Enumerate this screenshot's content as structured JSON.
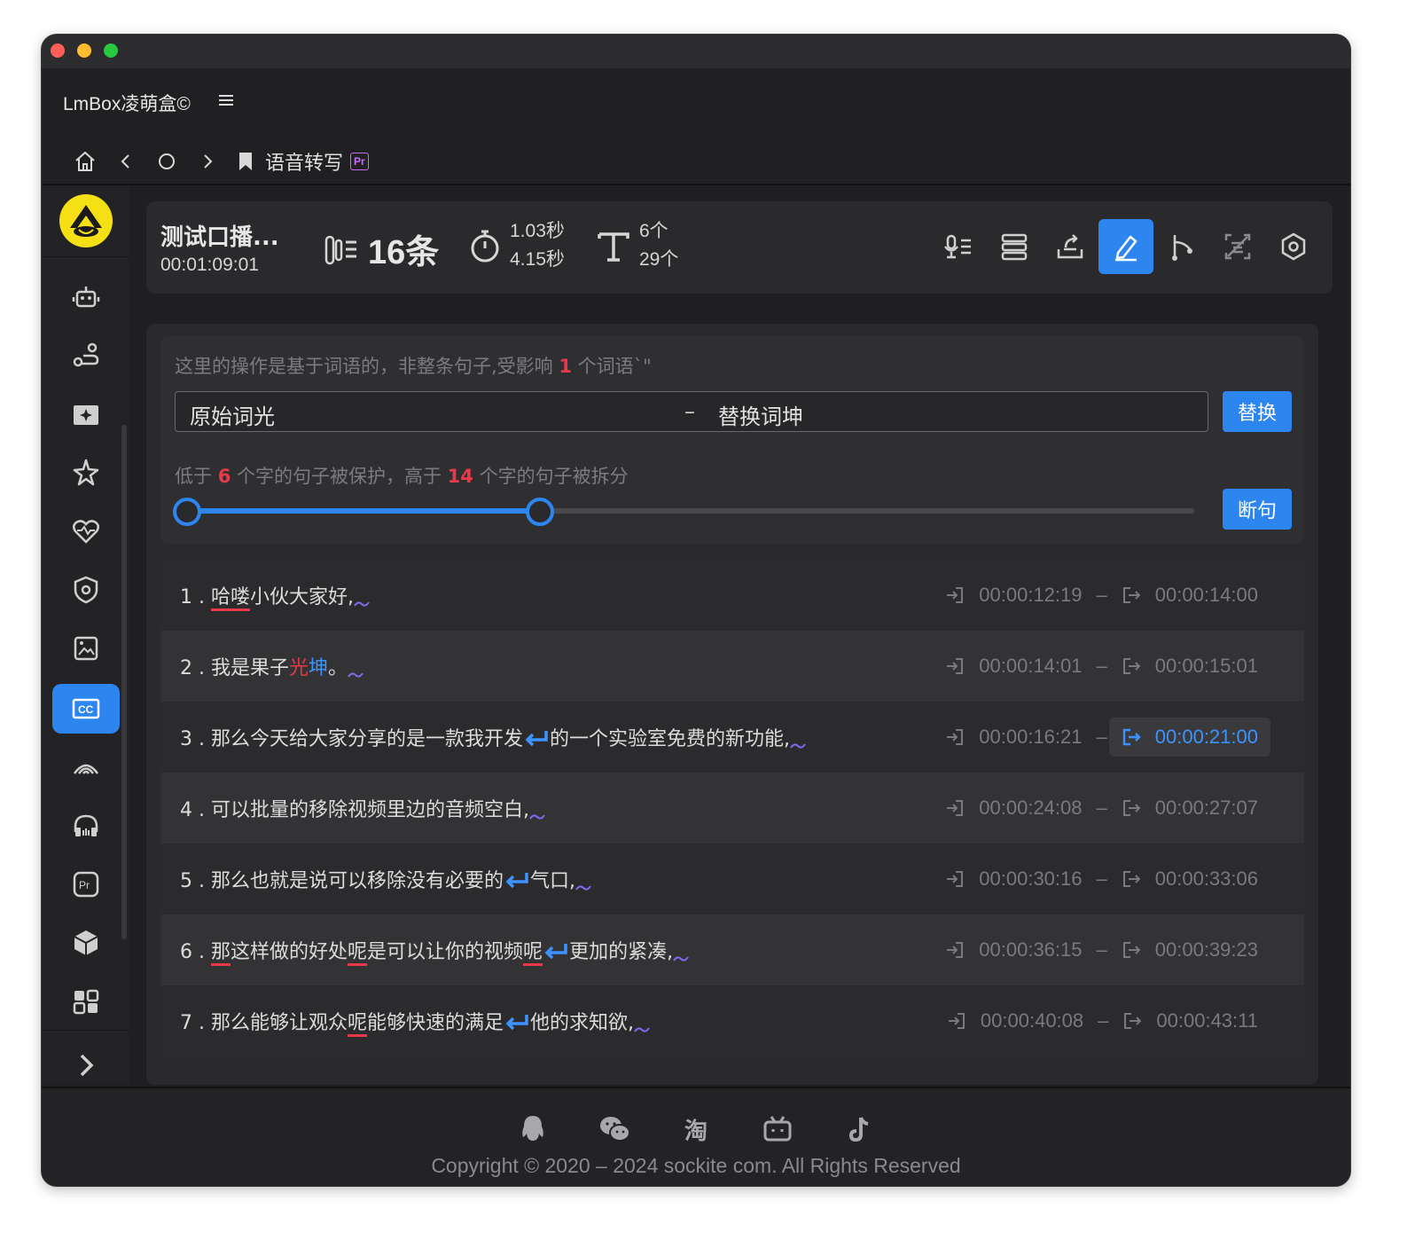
{
  "app": {
    "name": "LmBox凌萌盒©",
    "menu_icon": "menu-icon"
  },
  "nav": {
    "home_icon": "home-icon",
    "back_icon": "chevron-left-icon",
    "reload_icon": "circle-icon",
    "forward_icon": "chevron-right-icon",
    "bookmark_icon": "bookmark-icon",
    "breadcrumb": "语音转写",
    "badge": "Pr"
  },
  "sidebar": {
    "items": [
      {
        "icon": "robot-icon"
      },
      {
        "icon": "route-icon"
      },
      {
        "icon": "video-magic-icon"
      },
      {
        "icon": "sparkle-star-icon"
      },
      {
        "icon": "heartbeat-icon"
      },
      {
        "icon": "shield-icon"
      },
      {
        "icon": "image-icon"
      },
      {
        "icon": "cc-icon",
        "active": true
      },
      {
        "icon": "signal-icon"
      },
      {
        "icon": "headphones-icon"
      },
      {
        "icon": "premiere-icon"
      },
      {
        "icon": "cube-icon"
      },
      {
        "icon": "puzzle-icon"
      }
    ],
    "expand_icon": "chevron-right-icon"
  },
  "stats": {
    "title": "测试口播...",
    "duration": "00:01:09:01",
    "count": "16条",
    "time_min": "1.03秒",
    "time_max": "4.15秒",
    "chars_min": "6个",
    "chars_max": "29个"
  },
  "toolbar": {
    "buttons": [
      {
        "icon": "mic-list-icon"
      },
      {
        "icon": "stack-icon"
      },
      {
        "icon": "export-icon"
      },
      {
        "icon": "edit-icon",
        "active": true
      },
      {
        "icon": "branch-icon"
      },
      {
        "icon": "scan-icon"
      },
      {
        "icon": "settings-icon"
      }
    ]
  },
  "word_op": {
    "note_prefix": "这里的操作是基于词语的，非整条句子,受影响 ",
    "note_count": "1",
    "note_suffix": " 个词语`\"",
    "original": "原始词光",
    "dash": "–",
    "replacement": "替换词坤",
    "replace_label": "替换"
  },
  "split_op": {
    "prefix": "低于 ",
    "min": "6",
    "middle": " 个字的句子被保护，高于 ",
    "max": "14",
    "suffix": " 个字的句子被拆分",
    "button": "断句",
    "handle_a": 0,
    "handle_b": 0.35
  },
  "sentences": [
    {
      "num": "1 .",
      "in": "00:00:12:19",
      "out": "00:00:14:00"
    },
    {
      "num": "2 .",
      "in": "00:00:14:01",
      "out": "00:00:15:01"
    },
    {
      "num": "3 .",
      "in": "00:00:16:21",
      "out": "00:00:21:00"
    },
    {
      "num": "4 .",
      "in": "00:00:24:08",
      "out": "00:00:27:07"
    },
    {
      "num": "5 .",
      "in": "00:00:30:16",
      "out": "00:00:33:06"
    },
    {
      "num": "6 .",
      "in": "00:00:36:15",
      "out": "00:00:39:23"
    },
    {
      "num": "7 .",
      "in": "00:00:40:08",
      "out": "00:00:43:11"
    }
  ],
  "sentence_text": {
    "s1a": "哈喽",
    "s1b": "小伙大家好",
    "s2a": "我是果子",
    "s2b": "光",
    "s2c": "坤",
    "s2d": "。",
    "s3a": "那么今天给大家分享的是一款我开发",
    "s3b": "的一个实验室免费的新功能",
    "s4a": "可以批量的移除视频里边的音频空白",
    "s5a": "那么也就是说可以移除没有必要的",
    "s5b": "气口",
    "s6a": "那",
    "s6b": "这样做的好处",
    "s6c": "呢",
    "s6d": "是可以让你的视频",
    "s6e": "呢",
    "s6f": "更加的紧凑",
    "s7a": "那么能够让观众",
    "s7b": "呢",
    "s7c": "能够快速的满足",
    "s7d": "他的求知欲",
    "comma": ","
  },
  "footer": {
    "icons": [
      "qq-icon",
      "wechat-icon",
      "taobao-icon",
      "bilibili-icon",
      "tiktok-icon"
    ],
    "taobao_text": "淘",
    "copyright": "Copyright © 2020 – 2024 sockite com. All Rights Reserved"
  },
  "colors": {
    "accent": "#2d86f0",
    "highlight_red": "#e8384a",
    "logo_yellow": "#f5df15"
  }
}
